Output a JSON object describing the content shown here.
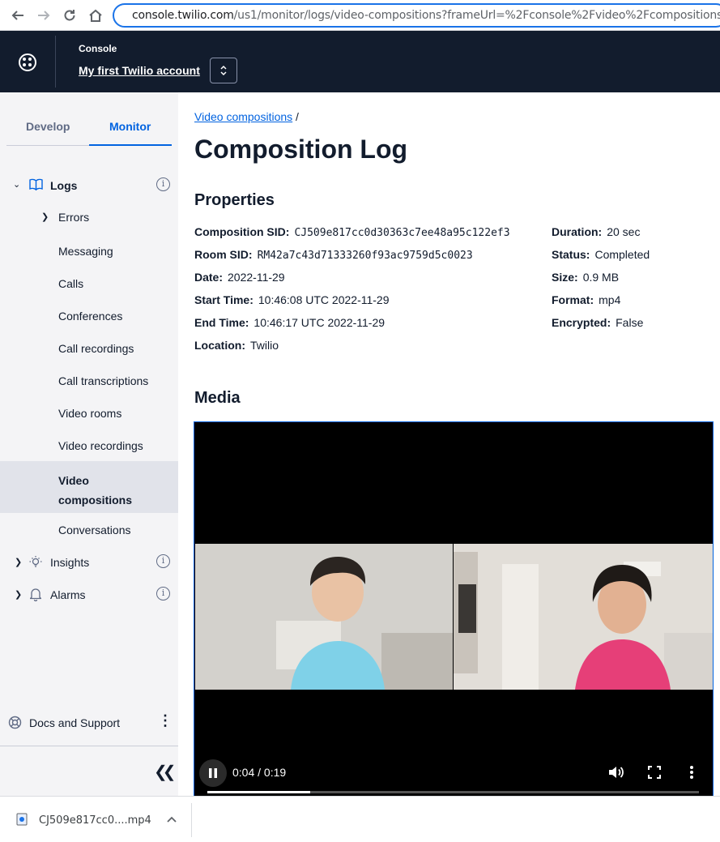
{
  "browser": {
    "url_host": "console.twilio.com",
    "url_path": "/us1/monitor/logs/video-compositions?frameUrl=%2Fconsole%2Fvideo%2Fcompositions%"
  },
  "header": {
    "console_label": "Console",
    "account_name": "My first Twilio account"
  },
  "sidebar": {
    "tabs": [
      "Develop",
      "Monitor"
    ],
    "active_tab": "Monitor",
    "logs_label": "Logs",
    "items": [
      {
        "label": "Errors"
      },
      {
        "label": "Messaging"
      },
      {
        "label": "Calls"
      },
      {
        "label": "Conferences"
      },
      {
        "label": "Call recordings"
      },
      {
        "label": "Call transcriptions"
      },
      {
        "label": "Video rooms"
      },
      {
        "label": "Video recordings"
      },
      {
        "label": "Video compositions",
        "line1": "Video",
        "line2": "compositions",
        "active": true
      },
      {
        "label": "Conversations"
      }
    ],
    "insights_label": "Insights",
    "alarms_label": "Alarms",
    "docs_label": "Docs and Support"
  },
  "main": {
    "breadcrumb": "Video compositions",
    "breadcrumb_sep": "/",
    "title": "Composition Log",
    "properties_title": "Properties",
    "properties_left": [
      {
        "key": "Composition SID:",
        "value": "CJ509e817cc0d30363c7ee48a95c122ef3",
        "mono": true
      },
      {
        "key": "Room SID:",
        "value": "RM42a7c43d71333260f93ac9759d5c0023",
        "mono": true
      },
      {
        "key": "Date:",
        "value": "2022-11-29"
      },
      {
        "key": "Start Time:",
        "value": "10:46:08 UTC 2022-11-29"
      },
      {
        "key": "End Time:",
        "value": "10:46:17 UTC 2022-11-29"
      },
      {
        "key": "Location:",
        "value": "Twilio"
      }
    ],
    "properties_right": [
      {
        "key": "Duration:",
        "value": "20 sec"
      },
      {
        "key": "Status:",
        "value": "Completed"
      },
      {
        "key": "Size:",
        "value": "0.9 MB"
      },
      {
        "key": "Format:",
        "value": "mp4"
      },
      {
        "key": "Encrypted:",
        "value": "False"
      }
    ],
    "media_title": "Media",
    "player": {
      "time": "0:04 / 0:19",
      "state": "playing",
      "progress": 0.21
    }
  },
  "downloads": {
    "file_name": "CJ509e817cc0....mp4"
  }
}
